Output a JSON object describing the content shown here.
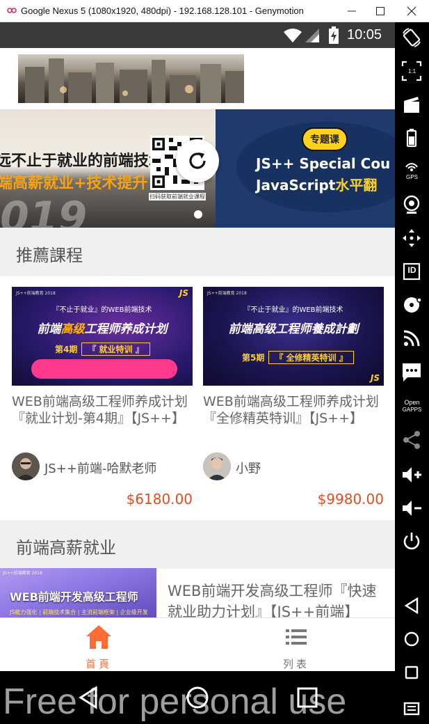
{
  "window": {
    "title": "Google Nexus 5 (1080x1920, 480dpi) - 192.168.128.101 - Genymotion"
  },
  "status_bar": {
    "time": "10:05"
  },
  "banner": {
    "slide_a": {
      "line1": "远不止于就业的前端技术",
      "line2": "端高薪就业+技术提升",
      "road_text": "019",
      "qr_caption": "扫码获取前端就业课程"
    },
    "slide_b": {
      "tag": "专题课",
      "line1": "JS++ Special Cou",
      "line2_main": "JavaScript",
      "line2_highlight": "水平翻"
    }
  },
  "sections": {
    "recommended": "推薦課程",
    "high_salary": "前端高薪就业"
  },
  "courses": [
    {
      "thumb_brand": "JS++前端教育 2018",
      "thumb_top": "『不止于就业』的WEB前端技术",
      "thumb_main_a": "前端",
      "thumb_main_hl": "高级",
      "thumb_main_b": "工程师养成计划",
      "thumb_phase": "第4期",
      "thumb_phase_box": "『 就业特训 』",
      "thumb_js": "JS",
      "title": "WEB前端高级工程师养成计划『就业计划-第4期』【JS++】",
      "author": "JS++前端-哈默老师",
      "price": "$6180.00"
    },
    {
      "thumb_brand": "JS++前端教育 2018",
      "thumb_top": "『不止于就业』的WEB前端技术",
      "thumb_main_a": "前端高级工程师",
      "thumb_main_hl": "",
      "thumb_main_b": "養成計劃",
      "thumb_phase": "第5期",
      "thumb_phase_box": "『 全修精英特训 』",
      "thumb_js": "JS",
      "title": "WEB前端高级工程师养成计划『全修精英特训』【JS++】",
      "author": "小野",
      "price": "$9980.00"
    }
  ],
  "list_course": {
    "thumb_brand": "JS++前端教育 2018",
    "thumb_title": "WEB前端开发高级工程师",
    "thumb_sub": "JS能力强化 | 前端技术集合 | 主流前端框架 | 企业级开发",
    "title": "WEB前端开发高级工程师『快速就业助力计划』【JS++前端】"
  },
  "tabs": [
    {
      "label": "首頁",
      "icon": "home-icon",
      "active": true
    },
    {
      "label": "列表",
      "icon": "list-icon",
      "active": false
    }
  ],
  "watermark": "Free for personal use",
  "sidebar": {
    "gps_label": "GPS",
    "open_gapps_label_1": "Open",
    "open_gapps_label_2": "GAPPS",
    "pixel_label": "1:1",
    "id_label": "ID"
  },
  "colors": {
    "accent": "#ff6b35",
    "price": "#e64b1e",
    "inactive_tab": "#777777"
  }
}
